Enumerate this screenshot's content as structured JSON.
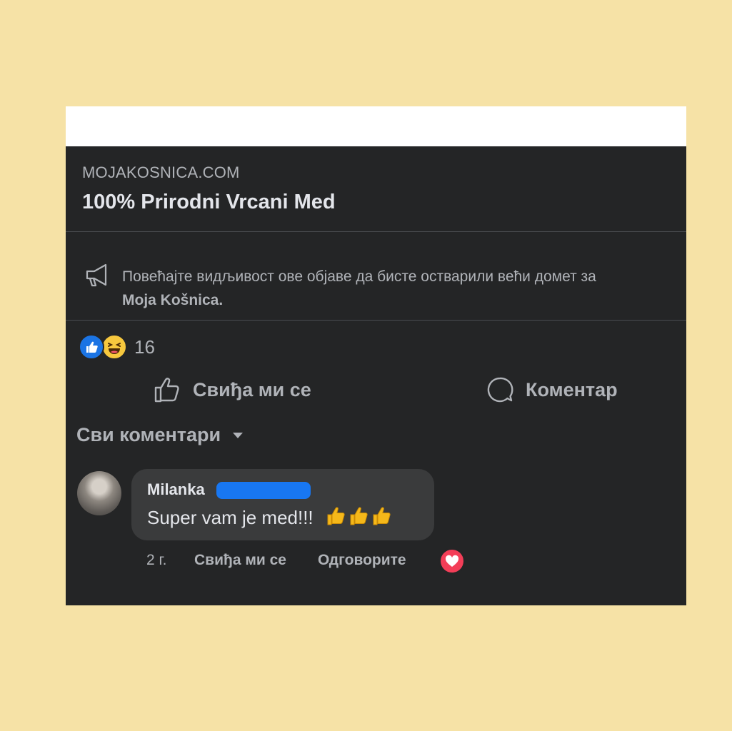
{
  "post": {
    "domain": "MOJAKOSNICA.COM",
    "link_title": "100% Prirodni Vrcani Med"
  },
  "promo": {
    "icon": "megaphone-icon",
    "text": "Повећајте видљивост ове објаве да бисте остварили већи домет за",
    "page_name": "Moja Košnica."
  },
  "reactions": {
    "types": [
      "like",
      "haha"
    ],
    "count": "16"
  },
  "actions": {
    "like_label": "Свиђа ми се",
    "comment_label": "Коментар"
  },
  "comments": {
    "filter_label": "Сви коментари",
    "items": [
      {
        "author": "Milanka",
        "text": "Super vam je med!!!",
        "emoji": "👍👍👍",
        "time": "2 г.",
        "like_label": "Свиђа ми се",
        "reply_label": "Одговорите",
        "reaction": "love"
      }
    ]
  },
  "colors": {
    "page_background": "#f6e2a6",
    "card_background": "#242526",
    "bubble_background": "#3a3b3c",
    "like_blue": "#1b74e4",
    "love_red": "#f33e58",
    "redaction_blue": "#1877f2"
  }
}
